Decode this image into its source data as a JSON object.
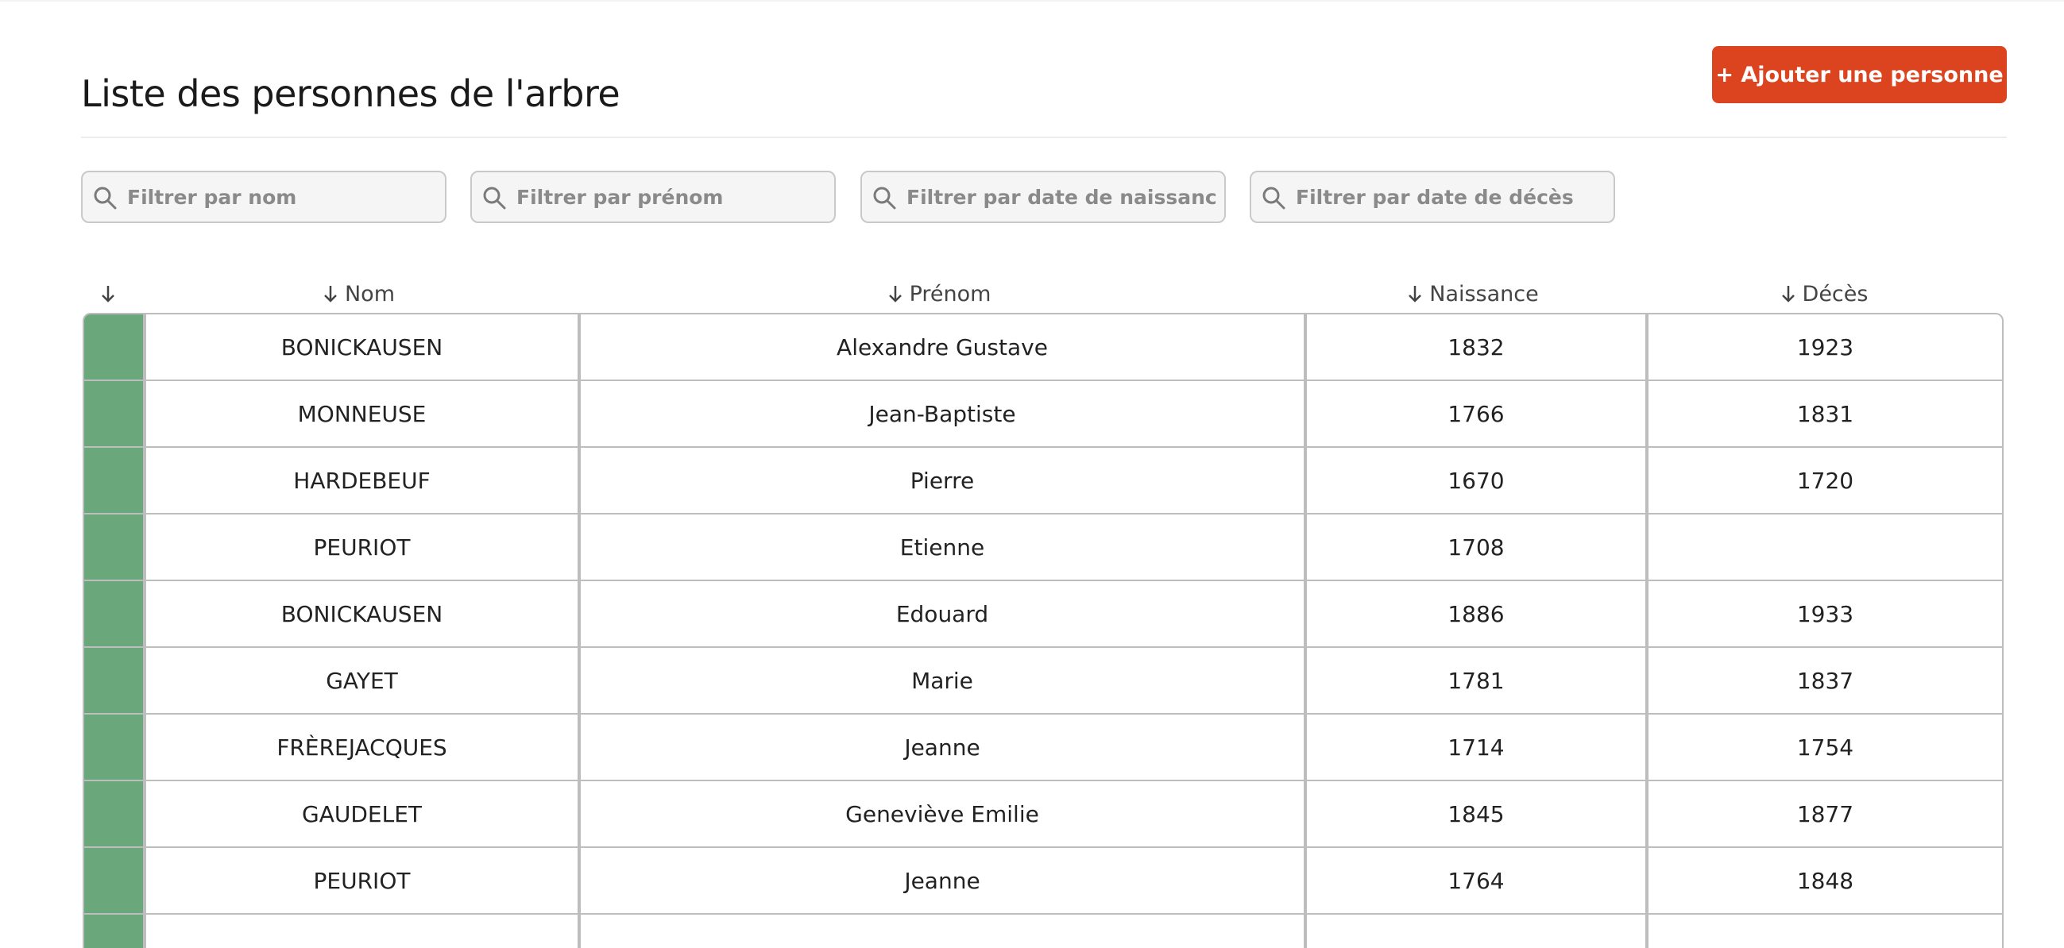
{
  "header": {
    "title": "Liste des personnes de l'arbre",
    "add_button_label": "+ Ajouter une personne",
    "accent_color": "#dc4420"
  },
  "filters": {
    "nom": {
      "placeholder": "Filtrer par nom",
      "value": "",
      "icon": "search-icon"
    },
    "prenom": {
      "placeholder": "Filtrer par prénom",
      "value": "",
      "icon": "search-icon"
    },
    "naissance": {
      "placeholder": "Filtrer par date de naissance",
      "value": "",
      "icon": "search-icon"
    },
    "deces": {
      "placeholder": "Filtrer par date de décès",
      "value": "",
      "icon": "search-icon"
    }
  },
  "table": {
    "sort_icon": "arrow-down-icon",
    "row_color": "#6aa77b",
    "columns": {
      "color": "",
      "nom": "Nom",
      "prenom": "Prénom",
      "naissance": "Naissance",
      "deces": "Décès"
    },
    "rows": [
      {
        "nom": "BONICKAUSEN",
        "prenom": "Alexandre Gustave",
        "naissance": "1832",
        "deces": "1923"
      },
      {
        "nom": "MONNEUSE",
        "prenom": "Jean-Baptiste",
        "naissance": "1766",
        "deces": "1831"
      },
      {
        "nom": "HARDEBEUF",
        "prenom": "Pierre",
        "naissance": "1670",
        "deces": "1720"
      },
      {
        "nom": "PEURIOT",
        "prenom": "Etienne",
        "naissance": "1708",
        "deces": ""
      },
      {
        "nom": "BONICKAUSEN",
        "prenom": "Edouard",
        "naissance": "1886",
        "deces": "1933"
      },
      {
        "nom": "GAYET",
        "prenom": "Marie",
        "naissance": "1781",
        "deces": "1837"
      },
      {
        "nom": "FRÈREJACQUES",
        "prenom": "Jeanne",
        "naissance": "1714",
        "deces": "1754"
      },
      {
        "nom": "GAUDELET",
        "prenom": "Geneviève Emilie",
        "naissance": "1845",
        "deces": "1877"
      },
      {
        "nom": "PEURIOT",
        "prenom": "Jeanne",
        "naissance": "1764",
        "deces": "1848"
      },
      {
        "nom": "",
        "prenom": "",
        "naissance": "",
        "deces": ""
      }
    ]
  }
}
